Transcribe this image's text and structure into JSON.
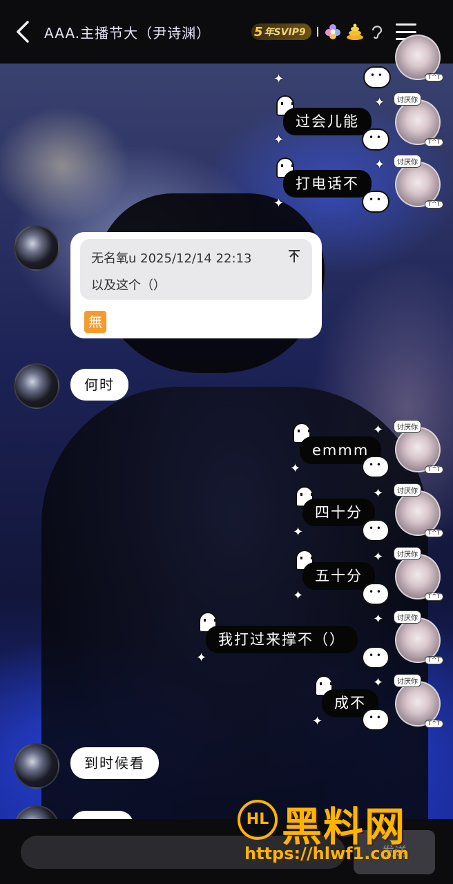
{
  "header": {
    "title": "AAA.主播节大（尹诗渊）",
    "vip_label": "年SVIP9",
    "vip_number": "5",
    "back_icon": "chevron-left-icon",
    "menu_icon": "hamburger-menu-icon"
  },
  "messages": {
    "right": [
      {
        "text": "过会儿能"
      },
      {
        "text": "打电话不"
      },
      {
        "text": "emmm"
      },
      {
        "text": "四十分"
      },
      {
        "text": "五十分"
      },
      {
        "text": "我打过来撑不（）"
      },
      {
        "text": "成不"
      }
    ],
    "left": [
      {
        "text": "何时"
      },
      {
        "text": "到时候看"
      }
    ],
    "avatar_tag": "讨厌你",
    "avatar_tt": "T^T"
  },
  "quote": {
    "author_time": "无名氧u 2025/12/14 22:13",
    "pin_icon": "pin-top-icon",
    "quoted_text": "以及这个（）",
    "emoji": "無"
  },
  "footer": {
    "send_label": "发送"
  },
  "watermark": {
    "logo": "HL",
    "title": "黑料网",
    "url": "https://hlwf1.com"
  }
}
